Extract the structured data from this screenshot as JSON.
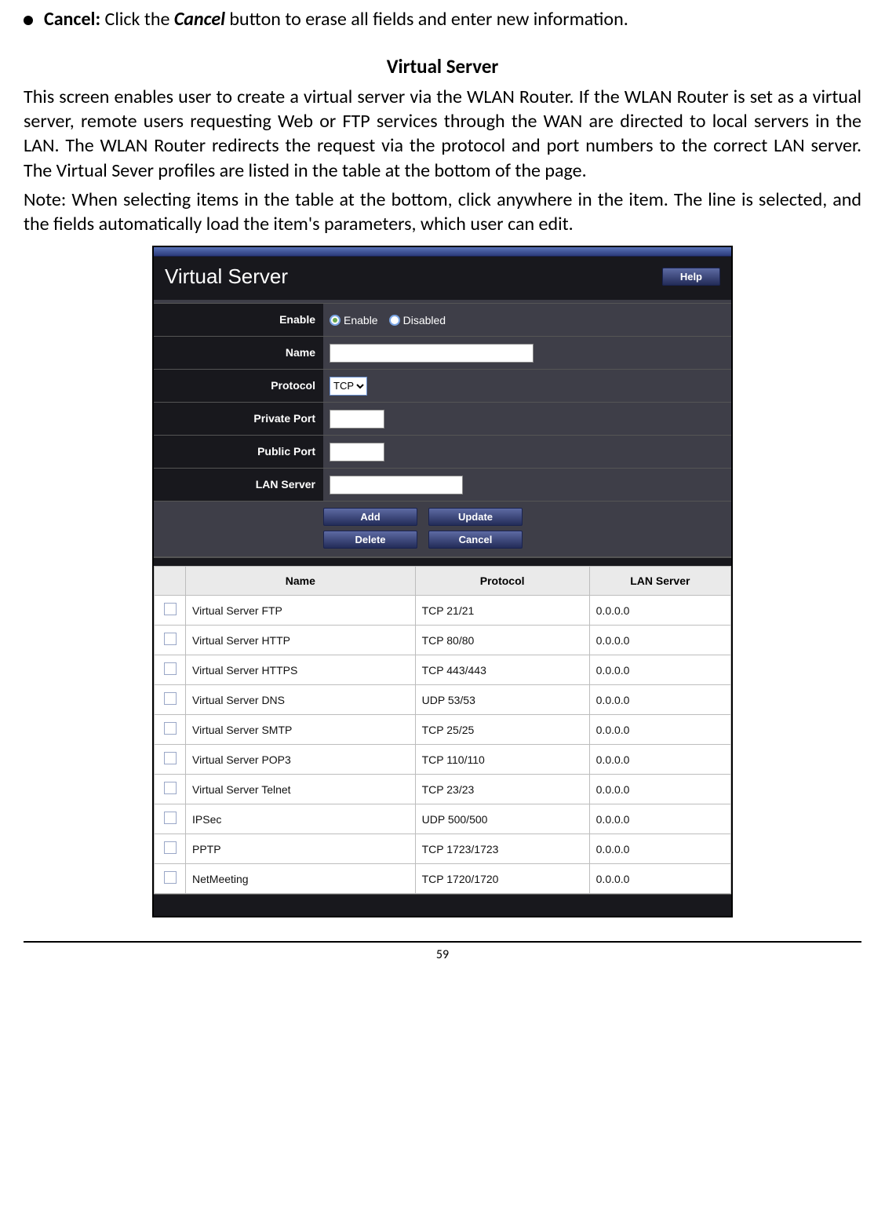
{
  "bullet": {
    "label": "Cancel:",
    "text_before": "Click the ",
    "emph": "Cancel",
    "text_after": " button to erase all fields and enter new information."
  },
  "section_title": "Virtual Server",
  "paragraph1": "This screen enables user to create a virtual server via the WLAN Router. If the WLAN Router is set as a virtual server, remote users requesting Web or FTP services through the WAN are directed to local servers in the LAN. The WLAN Router redirects the request via the protocol and port numbers to the correct LAN server. The Virtual Sever profiles are listed in the table at the bottom of the page.",
  "paragraph2": "Note: When selecting items in the table at the bottom, click anywhere in the item. The line is selected, and the fields automatically load the item's parameters, which user can edit.",
  "screenshot": {
    "title": "Virtual Server",
    "help_label": "Help",
    "form": {
      "enable_label": "Enable",
      "enable_option": "Enable",
      "disabled_option": "Disabled",
      "name_label": "Name",
      "protocol_label": "Protocol",
      "protocol_value": "TCP",
      "private_port_label": "Private Port",
      "public_port_label": "Public Port",
      "lan_server_label": "LAN Server"
    },
    "buttons": {
      "add": "Add",
      "update": "Update",
      "delete": "Delete",
      "cancel": "Cancel"
    },
    "table": {
      "headers": {
        "name": "Name",
        "protocol": "Protocol",
        "lan_server": "LAN Server"
      },
      "rows": [
        {
          "name": "Virtual Server FTP",
          "protocol": "TCP 21/21",
          "lan": "0.0.0.0"
        },
        {
          "name": "Virtual Server HTTP",
          "protocol": "TCP 80/80",
          "lan": "0.0.0.0"
        },
        {
          "name": "Virtual Server HTTPS",
          "protocol": "TCP 443/443",
          "lan": "0.0.0.0"
        },
        {
          "name": "Virtual Server DNS",
          "protocol": "UDP 53/53",
          "lan": "0.0.0.0"
        },
        {
          "name": "Virtual Server SMTP",
          "protocol": "TCP 25/25",
          "lan": "0.0.0.0"
        },
        {
          "name": "Virtual Server POP3",
          "protocol": "TCP 110/110",
          "lan": "0.0.0.0"
        },
        {
          "name": "Virtual Server Telnet",
          "protocol": "TCP 23/23",
          "lan": "0.0.0.0"
        },
        {
          "name": "IPSec",
          "protocol": "UDP 500/500",
          "lan": "0.0.0.0"
        },
        {
          "name": "PPTP",
          "protocol": "TCP 1723/1723",
          "lan": "0.0.0.0"
        },
        {
          "name": "NetMeeting",
          "protocol": "TCP 1720/1720",
          "lan": "0.0.0.0"
        }
      ]
    }
  },
  "page_number": "59"
}
